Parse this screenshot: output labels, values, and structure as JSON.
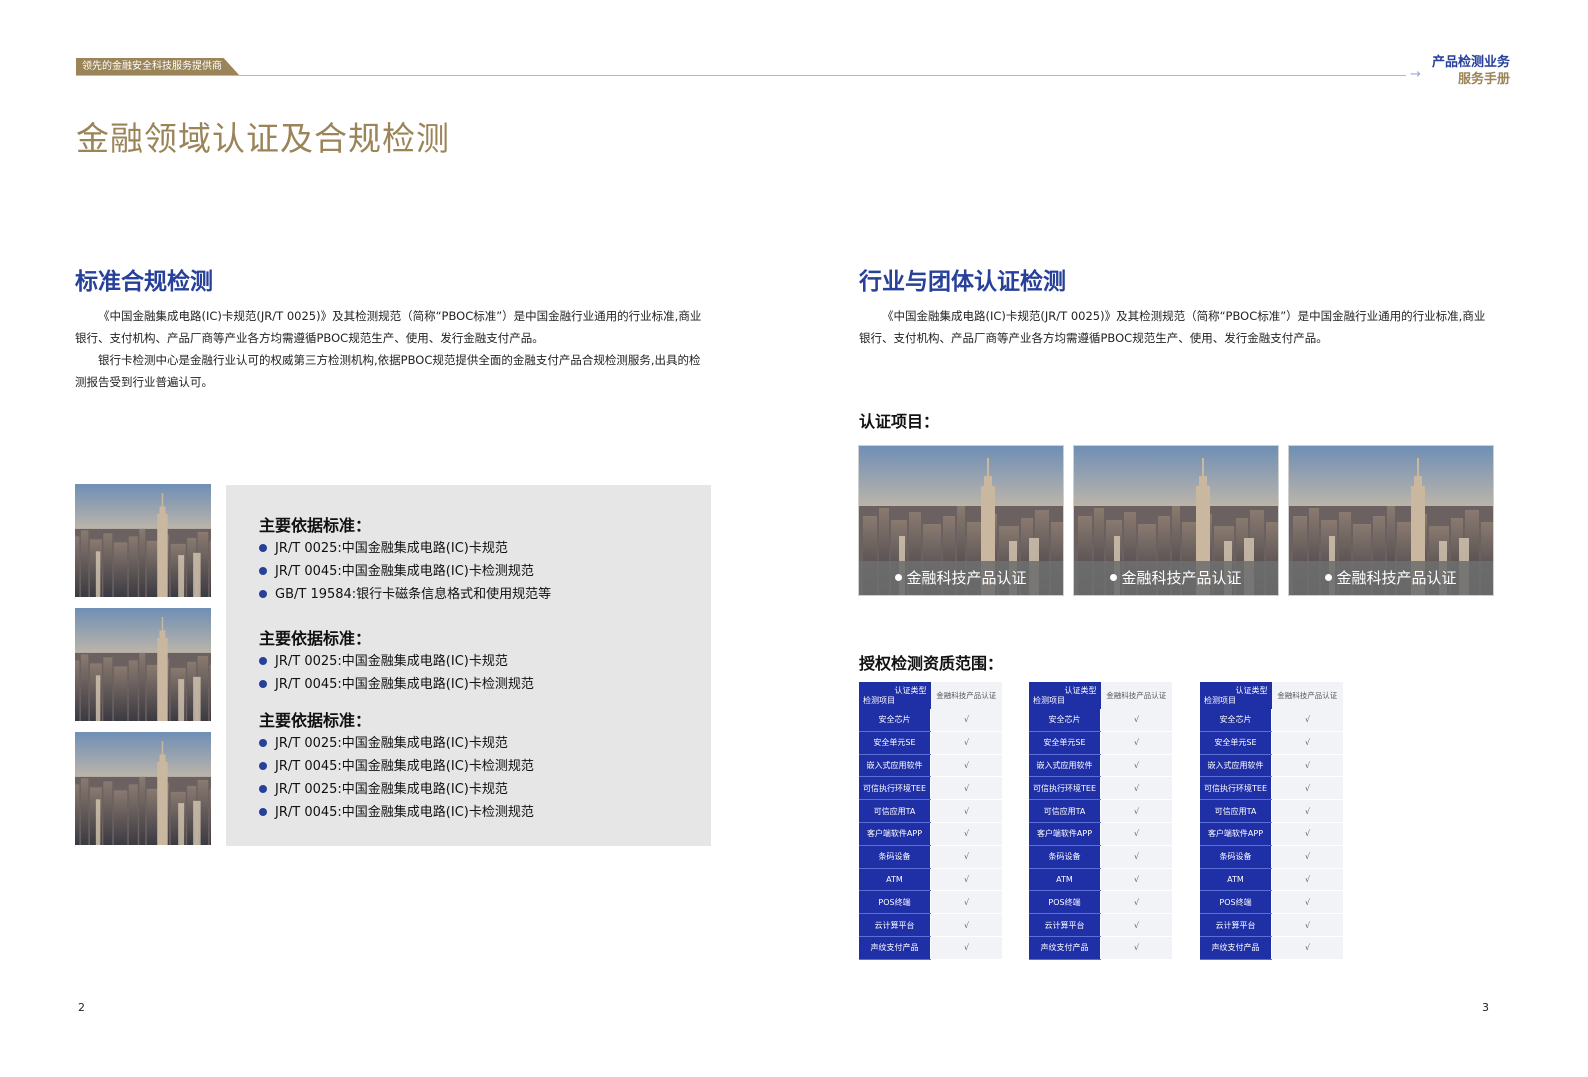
{
  "header": {
    "tag": "领先的金融安全科技服务提供商",
    "right_title": "产品检测业务",
    "right_sub": "服务手册",
    "arrow": "→"
  },
  "page_title": "金融领域认证及合规检测",
  "left": {
    "section_title": "标准合规检测",
    "paragraphs": [
      "《中国金融集成电路(IC)卡规范(JR/T 0025)》及其检测规范（简称“PBOC标准”）是中国金融行业通用的行业标准,商业银行、支付机构、产品厂商等产业各方均需遵循PBOC规范生产、使用、发行金融支付产品。",
      "银行卡检测中心是金融行业认可的权威第三方检测机构,依据PBOC规范提供全面的金融支付产品合规检测服务,出具的检测报告受到行业普遍认可。"
    ],
    "standards": [
      {
        "heading": "主要依据标准：",
        "items": [
          "JR/T 0025:中国金融集成电路(IC)卡规范",
          "JR/T 0045:中国金融集成电路(IC)卡检测规范",
          "GB/T 19584:银行卡磁条信息格式和使用规范等"
        ]
      },
      {
        "heading": "主要依据标准：",
        "items": [
          "JR/T 0025:中国金融集成电路(IC)卡规范",
          "JR/T 0045:中国金融集成电路(IC)卡检测规范"
        ]
      },
      {
        "heading": "主要依据标准：",
        "items": [
          "JR/T 0025:中国金融集成电路(IC)卡规范",
          "JR/T 0045:中国金融集成电路(IC)卡检测规范",
          "JR/T 0025:中国金融集成电路(IC)卡规范",
          "JR/T 0045:中国金融集成电路(IC)卡检测规范"
        ]
      }
    ],
    "page_number": "2"
  },
  "right": {
    "section_title": "行业与团体认证检测",
    "paragraph": "《中国金融集成电路(IC)卡规范(JR/T 0025)》及其检测规范（简称“PBOC标准”）是中国金融行业通用的行业标准,商业银行、支付机构、产品厂商等产业各方均需遵循PBOC规范生产、使用、发行金融支付产品。",
    "cert_heading": "认证项目：",
    "cards": [
      "金融科技产品认证",
      "金融科技产品认证",
      "金融科技产品认证"
    ],
    "qual_heading": "授权检测资质范围：",
    "table": {
      "header_top": "认证类型",
      "header_bottom": "检测项目",
      "header_right": "金融科技产品认证",
      "rows": [
        "安全芯片",
        "安全单元SE",
        "嵌入式应用软件",
        "可信执行环境TEE",
        "可信应用TA",
        "客户端软件APP",
        "条码设备",
        "ATM",
        "POS终端",
        "云计算平台",
        "声纹支付产品"
      ],
      "check": "√"
    },
    "page_number": "3"
  }
}
